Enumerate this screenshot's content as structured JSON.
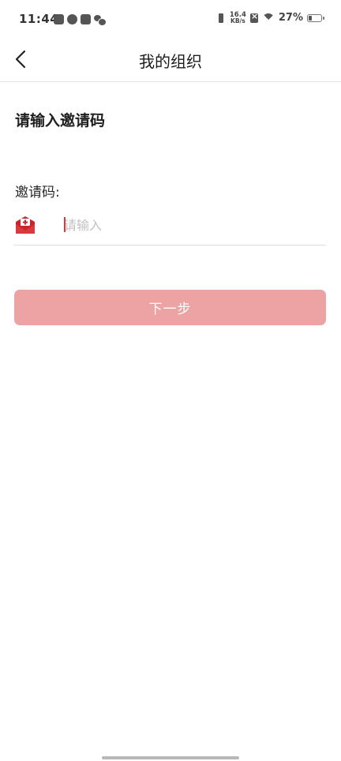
{
  "status_bar": {
    "time": "11:44",
    "net_speed_value": "16.4",
    "net_speed_unit": "KB/s",
    "battery_percent": "27%",
    "battery_level": 0.27,
    "notification_icons": [
      "mail-icon",
      "check-shield-icon",
      "message-icon",
      "wechat-icon"
    ],
    "system_icons": [
      "vibrate-icon",
      "no-sim-icon",
      "wifi-icon",
      "battery-icon"
    ]
  },
  "header": {
    "title": "我的组织",
    "back_icon": "chevron-left-icon"
  },
  "form": {
    "heading": "请输入邀请码",
    "field_label": "邀请码:",
    "input_placeholder": "请输入",
    "input_value": "",
    "input_icon": "envelope-plus-icon",
    "next_button_label": "下一步"
  },
  "colors": {
    "accent": "#d63a3a",
    "button_disabled": "#eda3a3",
    "divider": "#e3e3e3"
  }
}
